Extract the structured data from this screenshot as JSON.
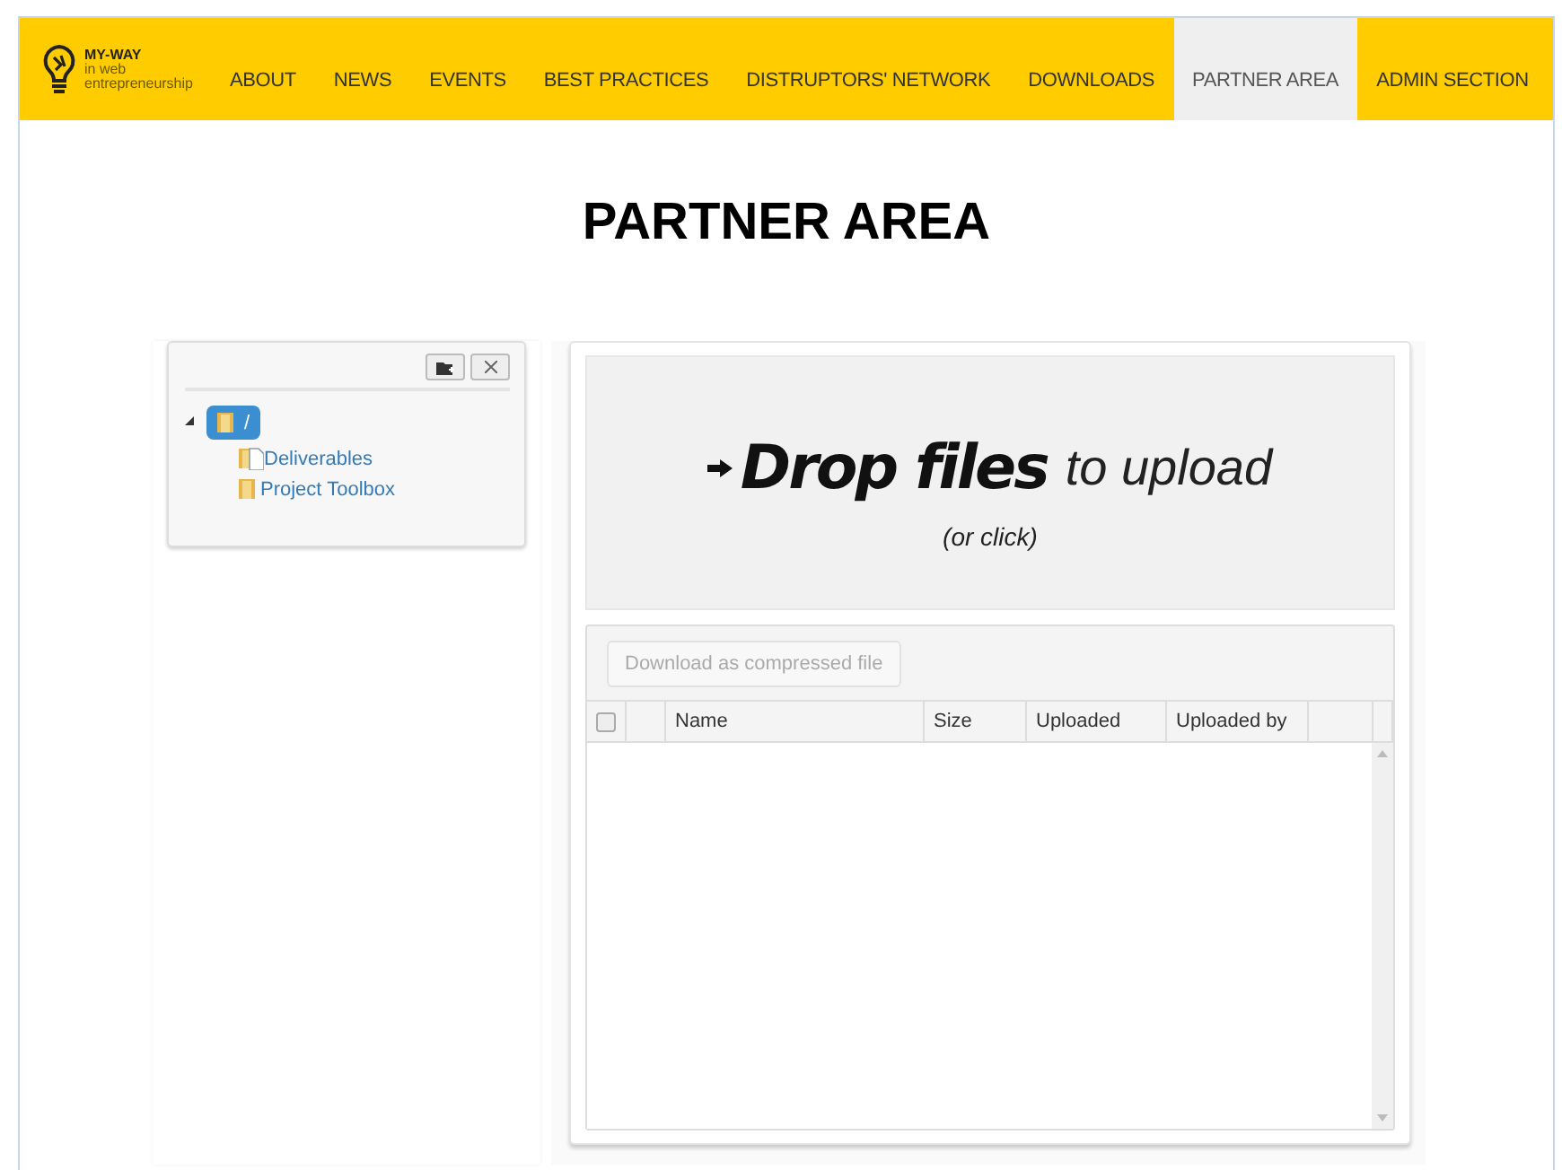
{
  "logo": {
    "title": "MY-WAY",
    "subtitle": "in web",
    "subtitle_2": "entrepreneurship"
  },
  "nav": [
    {
      "label": "ABOUT",
      "selected": false
    },
    {
      "label": "NEWS",
      "selected": false
    },
    {
      "label": "EVENTS",
      "selected": false
    },
    {
      "label": "BEST PRACTICES",
      "selected": false
    },
    {
      "label": "DISTRUPTORS' NETWORK",
      "selected": false
    },
    {
      "label": "DOWNLOADS",
      "selected": false
    },
    {
      "label": "PARTNER AREA",
      "selected": true
    },
    {
      "label": "ADMIN SECTION",
      "selected": false
    }
  ],
  "page_title": "PARTNER AREA",
  "tree": {
    "label": "/",
    "selected": true,
    "expanded": true,
    "children": [
      {
        "label": "Deliverables",
        "selected": false,
        "kind": "document"
      },
      {
        "label": "Project Toolbox",
        "selected": false,
        "kind": "folder"
      }
    ]
  },
  "upload": {
    "headline": "Drop files",
    "headline_rest": "to upload",
    "hint": "(or click)"
  },
  "files": {
    "download_button": {
      "label": "Download as compressed file",
      "disabled": true
    },
    "select_all": {
      "checked": false
    },
    "columns": [
      "Name",
      "Size",
      "Uploaded",
      "Uploaded by"
    ]
  }
}
